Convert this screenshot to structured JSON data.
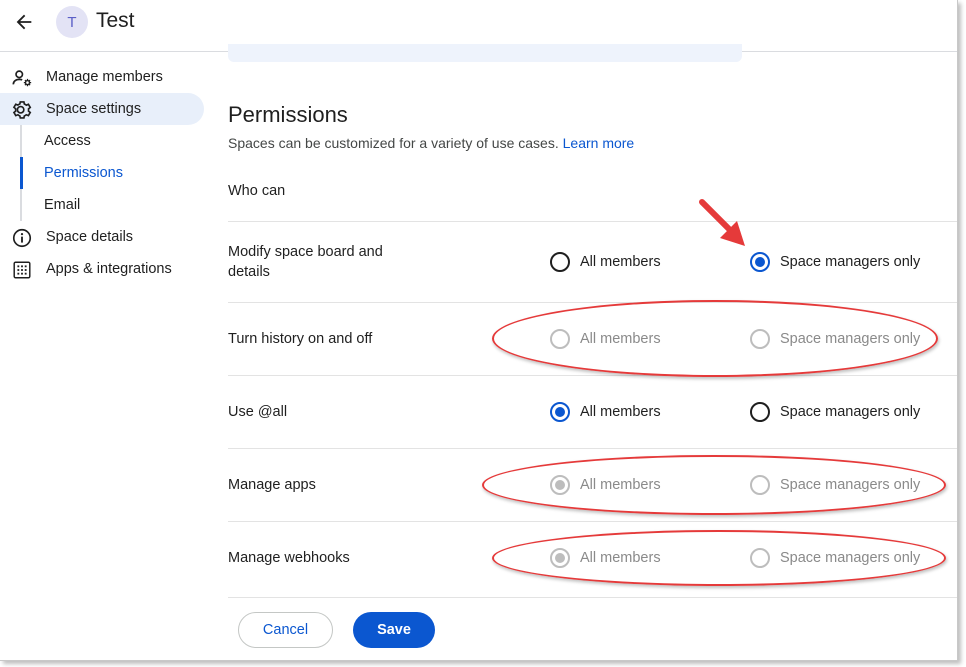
{
  "header": {
    "avatar_letter": "T",
    "space_name": "Test"
  },
  "sidebar": {
    "items": [
      {
        "label": "Manage members",
        "icon": "manage-members-icon"
      },
      {
        "label": "Space settings",
        "icon": "gear-icon",
        "active": true
      },
      {
        "label": "Space details",
        "icon": "info-icon"
      },
      {
        "label": "Apps & integrations",
        "icon": "apps-grid-icon"
      }
    ],
    "sub_items": [
      {
        "label": "Access"
      },
      {
        "label": "Permissions",
        "active": true
      },
      {
        "label": "Email"
      }
    ]
  },
  "main": {
    "title": "Permissions",
    "subtitle": "Spaces can be customized for a variety of use cases.",
    "learn_more": "Learn more",
    "who_can": "Who can",
    "rows": [
      {
        "label": "Modify space board and details",
        "selected": "Space managers only",
        "disabled": false
      },
      {
        "label": "Turn history on and off",
        "selected": "none",
        "disabled": true
      },
      {
        "label": "Use @all",
        "selected": "All members",
        "disabled": false
      },
      {
        "label": "Manage apps",
        "selected": "All members",
        "disabled": true
      },
      {
        "label": "Manage webhooks",
        "selected": "All members",
        "disabled": true
      }
    ],
    "option_all": "All members",
    "option_managers": "Space managers only"
  },
  "footer": {
    "cancel": "Cancel",
    "save": "Save"
  },
  "colors": {
    "accent": "#0b57d0",
    "annotation": "#e53a3a",
    "active_nav_bg": "#e8effa"
  }
}
